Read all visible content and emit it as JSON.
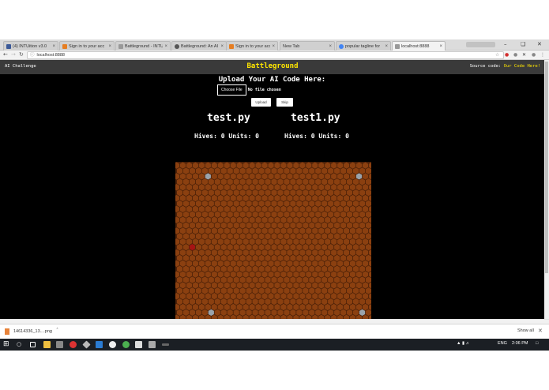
{
  "browser": {
    "tabs": [
      {
        "title": "(4) INTUition v3.0",
        "favicon_color": "#3b5998"
      },
      {
        "title": "Sign in to your acc",
        "favicon_color": "#e67e22"
      },
      {
        "title": "Battleground - INTU",
        "favicon_color": "#999999"
      },
      {
        "title": "Battleground: An AI",
        "favicon_color": "#555555"
      },
      {
        "title": "Sign in to your acc",
        "favicon_color": "#e67e22"
      },
      {
        "title": "New Tab",
        "favicon_color": ""
      },
      {
        "title": "popular tagline for",
        "favicon_color": "#4285f4"
      },
      {
        "title": "localhost:8888",
        "favicon_color": "#999999"
      }
    ],
    "url": "localhost:8888",
    "window_controls": {
      "minimize": "–",
      "maximize": "❏",
      "close": "✕"
    },
    "tab_close": "×"
  },
  "header": {
    "left": "AI Challenge",
    "title": "Battleground",
    "source_label": "Source code:",
    "source_link": "Our Code Here!"
  },
  "upload": {
    "heading": "Upload Your AI Code Here:",
    "choose_file": "Choose File",
    "no_file": "No file chosen",
    "upload_button": "Upload",
    "skip_button": "Skip"
  },
  "players": [
    {
      "name": "test.py",
      "hives_label": "Hives:",
      "hives": "0",
      "units_label": "Units:",
      "units": "0"
    },
    {
      "name": "test1.py",
      "hives_label": "Hives:",
      "hives": "0",
      "units_label": "Units:",
      "units": "0"
    }
  ],
  "board": {
    "hex_color": "#8b4010",
    "hex_edge": "#4a2008",
    "hive_color": "#9aa3ab",
    "enemy_color": "#a61414"
  },
  "downloads": {
    "file": "14614336_13....png",
    "show_all": "Show all"
  },
  "taskbar": {
    "lang": "ENG",
    "time": "2:06 PM"
  },
  "colors": {
    "accent": "#ffe600",
    "page_bg": "#000000",
    "header_bg": "#3a3a3a"
  }
}
